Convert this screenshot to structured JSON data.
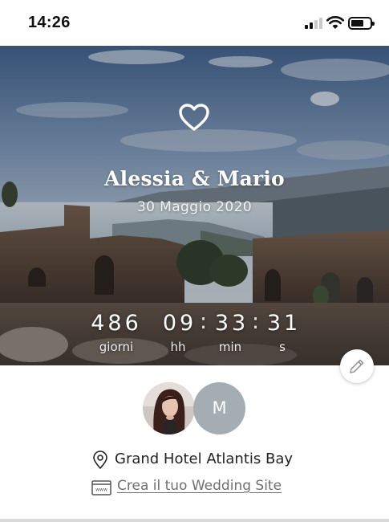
{
  "status_bar": {
    "time": "14:26",
    "icons": [
      "cellular-signal-icon",
      "wifi-icon",
      "battery-icon"
    ]
  },
  "hero": {
    "icon": "heart-outline-icon",
    "names": "Alessia & Mario",
    "date": "30 Maggio 2020",
    "background": "photo of ancient greek theatre ruins overlooking the sea and coastline"
  },
  "countdown": {
    "days": "486",
    "days_label": "giorni",
    "hours": "09",
    "hours_label": "hh",
    "minutes": "33",
    "minutes_label": "min",
    "seconds": "31",
    "seconds_label": "s",
    "separator": ":"
  },
  "edit": {
    "icon": "pencil-icon"
  },
  "avatars": {
    "partner_photo": "photo of woman with long dark hair",
    "partner_initial": "M"
  },
  "venue": {
    "icon": "location-pin-icon",
    "name": "Grand Hotel Atlantis Bay"
  },
  "website": {
    "icon": "web-browser-icon",
    "link_text": "Crea il tuo Wedding Site"
  },
  "colors": {
    "avatar_grey": "#a4adb4",
    "link_grey": "#707070",
    "text_dark": "#222222"
  }
}
